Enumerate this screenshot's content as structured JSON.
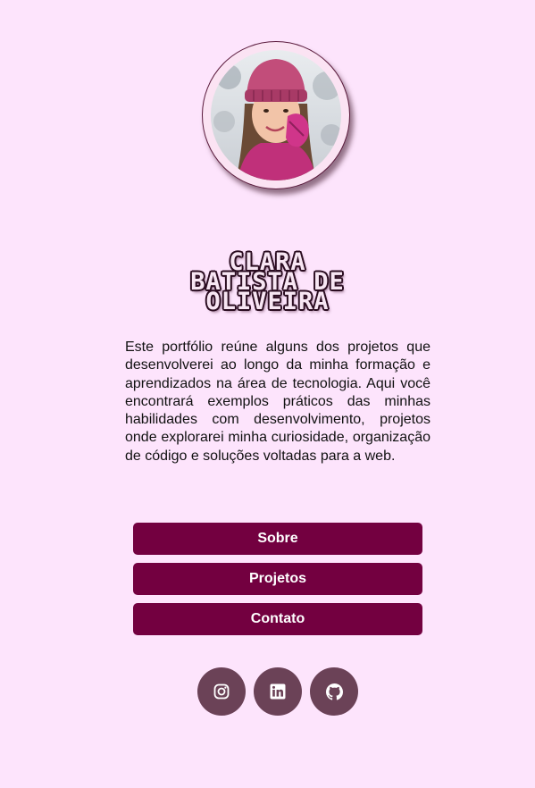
{
  "profile": {
    "photo": "profile-photo",
    "name_lines": [
      "CLARA",
      "BATISTA DE",
      "OLIVEIRA"
    ],
    "intro": "Este portfólio reúne alguns dos projetos que desenvolverei ao longo da minha formação e aprendizados na área de tecnologia. Aqui você encontrará exemplos práticos das minhas habilidades com desenvolvimento, projetos onde explorarei minha curiosidade, organização de código e soluções voltadas para a web."
  },
  "nav": {
    "about_label": "Sobre",
    "projects_label": "Projetos",
    "contact_label": "Contato"
  },
  "social": {
    "icons": [
      "instagram-icon",
      "linkedin-icon",
      "github-icon"
    ]
  },
  "colors": {
    "background": "#fde4fc",
    "button": "#730040",
    "social_button": "#6b4257"
  }
}
